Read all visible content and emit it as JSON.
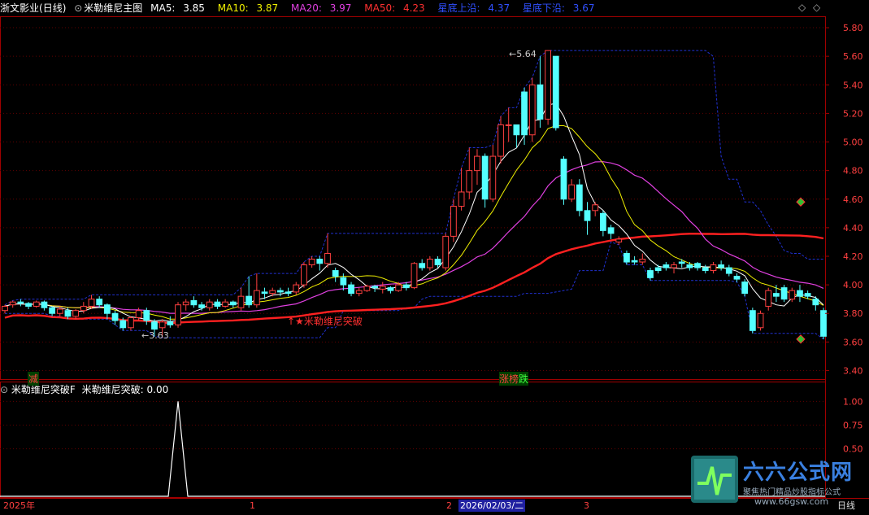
{
  "header": {
    "stock_name": "浙文影业",
    "period": "(日线)",
    "indicator_name": "米勒维尼主图",
    "ma5": {
      "label": "MA5:",
      "value": "3.85",
      "color": "#ffffff"
    },
    "ma10": {
      "label": "MA10:",
      "value": "3.87",
      "color": "#f0f000"
    },
    "ma20": {
      "label": "MA20:",
      "value": "3.97",
      "color": "#e040e0"
    },
    "ma50": {
      "label": "MA50:",
      "value": "4.23",
      "color": "#ff3030"
    },
    "upper": {
      "label": "星底上沿:",
      "value": "4.37",
      "color": "#2040ff"
    },
    "lower": {
      "label": "星底下沿:",
      "value": "3.67",
      "color": "#2040ff"
    }
  },
  "sub_header": {
    "indicator_name": "米勒维尼突破F",
    "value_label": "米勒维尼突破:",
    "value": "0.00"
  },
  "annotations": {
    "high": "5.64",
    "low": "3.63",
    "breakout": "米勒维尼突破",
    "tag_left": "减",
    "tag_mid_a": "涨",
    "tag_mid_b": "榜",
    "tag_mid_c": "跌"
  },
  "time_axis": {
    "labels": [
      "2025年",
      "1",
      "2",
      "3"
    ],
    "cursor_date": "2026/02/03/二",
    "period_label": "日线"
  },
  "price_axis": {
    "ticks": [
      "5.80",
      "5.60",
      "5.40",
      "5.20",
      "5.00",
      "4.80",
      "4.60",
      "4.40",
      "4.20",
      "4.00",
      "3.80",
      "3.60",
      "3.40"
    ]
  },
  "sub_axis": {
    "ticks": [
      "1.00",
      "0.75",
      "0.50"
    ]
  },
  "watermark": {
    "title": "六六公式网",
    "subtitle": "聚焦热门精品炒股指标公式",
    "url": "www.66gsw.com"
  },
  "chart_data": [
    {
      "type": "candlestick",
      "title": "米勒维尼主图",
      "ylim": [
        3.34,
        5.88
      ],
      "up_color": "#ff4040",
      "down_color": "#54ffff",
      "candles": [
        [
          3.82,
          3.85,
          3.8,
          3.86
        ],
        [
          3.86,
          3.88,
          3.84,
          3.89
        ],
        [
          3.88,
          3.87,
          3.85,
          3.9
        ],
        [
          3.87,
          3.85,
          3.83,
          3.88
        ],
        [
          3.85,
          3.88,
          3.84,
          3.89
        ],
        [
          3.88,
          3.84,
          3.82,
          3.89
        ],
        [
          3.84,
          3.8,
          3.78,
          3.85
        ],
        [
          3.8,
          3.83,
          3.78,
          3.85
        ],
        [
          3.82,
          3.78,
          3.76,
          3.84
        ],
        [
          3.78,
          3.82,
          3.76,
          3.83
        ],
        [
          3.82,
          3.85,
          3.8,
          3.88
        ],
        [
          3.85,
          3.9,
          3.83,
          3.93
        ],
        [
          3.9,
          3.86,
          3.84,
          3.92
        ],
        [
          3.86,
          3.8,
          3.76,
          3.87
        ],
        [
          3.8,
          3.75,
          3.72,
          3.82
        ],
        [
          3.75,
          3.7,
          3.68,
          3.77
        ],
        [
          3.7,
          3.77,
          3.68,
          3.78
        ],
        [
          3.77,
          3.82,
          3.75,
          3.84
        ],
        [
          3.82,
          3.75,
          3.72,
          3.84
        ],
        [
          3.74,
          3.69,
          3.64,
          3.76
        ],
        [
          3.7,
          3.74,
          3.63,
          3.76
        ],
        [
          3.74,
          3.72,
          3.7,
          3.78
        ],
        [
          3.72,
          3.86,
          3.7,
          3.88
        ],
        [
          3.86,
          3.88,
          3.82,
          3.9
        ],
        [
          3.89,
          3.86,
          3.84,
          3.92
        ],
        [
          3.86,
          3.84,
          3.82,
          3.88
        ],
        [
          3.84,
          3.88,
          3.82,
          3.9
        ],
        [
          3.88,
          3.85,
          3.83,
          3.9
        ],
        [
          3.85,
          3.88,
          3.84,
          3.9
        ],
        [
          3.88,
          3.86,
          3.84,
          3.89
        ],
        [
          3.84,
          3.92,
          3.82,
          3.98
        ],
        [
          3.92,
          3.86,
          3.84,
          4.06
        ],
        [
          3.86,
          3.96,
          3.84,
          4.08
        ],
        [
          3.95,
          3.94,
          3.9,
          3.98
        ],
        [
          3.94,
          3.96,
          3.92,
          3.98
        ],
        [
          3.96,
          3.95,
          3.92,
          3.98
        ],
        [
          3.95,
          3.94,
          3.92,
          3.98
        ],
        [
          3.95,
          4.0,
          3.93,
          4.02
        ],
        [
          4.0,
          4.14,
          3.98,
          4.16
        ],
        [
          4.14,
          4.18,
          4.12,
          4.2
        ],
        [
          4.18,
          4.15,
          4.1,
          4.2
        ],
        [
          4.15,
          4.22,
          4.12,
          4.36
        ],
        [
          4.1,
          4.06,
          4.02,
          4.12
        ],
        [
          4.05,
          4.0,
          3.96,
          4.08
        ],
        [
          4.0,
          3.94,
          3.92,
          4.02
        ],
        [
          3.94,
          3.96,
          3.92,
          3.98
        ],
        [
          3.96,
          3.99,
          3.95,
          4.0
        ],
        [
          3.99,
          3.98,
          3.95,
          4.0
        ],
        [
          3.97,
          3.99,
          3.94,
          4.02
        ],
        [
          3.98,
          3.96,
          3.94,
          3.99
        ],
        [
          3.96,
          4.0,
          3.95,
          4.02
        ],
        [
          4.0,
          3.98,
          3.96,
          4.02
        ],
        [
          3.98,
          4.15,
          3.97,
          4.16
        ],
        [
          4.15,
          4.12,
          4.1,
          4.18
        ],
        [
          4.12,
          4.18,
          4.1,
          4.2
        ],
        [
          4.18,
          4.14,
          4.12,
          4.2
        ],
        [
          4.12,
          4.34,
          4.1,
          4.36
        ],
        [
          4.34,
          4.55,
          4.3,
          4.6
        ],
        [
          4.55,
          4.65,
          4.52,
          4.82
        ],
        [
          4.65,
          4.8,
          4.6,
          4.96
        ],
        [
          4.8,
          4.9,
          4.7,
          4.95
        ],
        [
          4.9,
          4.6,
          4.54,
          4.92
        ],
        [
          4.6,
          4.9,
          4.58,
          4.98
        ],
        [
          4.9,
          5.12,
          4.85,
          5.18
        ],
        [
          5.12,
          5.12,
          5.0,
          5.24
        ],
        [
          5.12,
          5.05,
          4.96,
          5.1
        ],
        [
          5.35,
          5.05,
          4.98,
          5.38
        ],
        [
          5.05,
          5.4,
          5.0,
          5.45
        ],
        [
          5.4,
          5.16,
          5.1,
          5.6
        ],
        [
          5.16,
          5.64,
          5.12,
          5.64
        ],
        [
          5.6,
          5.1,
          5.08,
          5.6
        ],
        [
          4.88,
          4.6,
          4.56,
          4.9
        ],
        [
          4.6,
          4.7,
          4.58,
          4.74
        ],
        [
          4.7,
          4.52,
          4.48,
          4.74
        ],
        [
          4.52,
          4.45,
          4.35,
          4.58
        ],
        [
          4.52,
          4.56,
          4.48,
          4.58
        ],
        [
          4.5,
          4.38,
          4.34,
          4.52
        ],
        [
          4.4,
          4.36,
          4.32,
          4.42
        ],
        [
          4.3,
          4.32,
          4.28,
          4.34
        ],
        [
          4.22,
          4.16,
          4.14,
          4.24
        ],
        [
          4.17,
          4.16,
          4.14,
          4.2
        ],
        [
          4.16,
          4.18,
          4.14,
          4.22
        ],
        [
          4.1,
          4.05,
          4.03,
          4.12
        ],
        [
          4.12,
          4.1,
          4.08,
          4.14
        ],
        [
          4.14,
          4.12,
          4.1,
          4.16
        ],
        [
          4.12,
          4.14,
          4.08,
          4.16
        ],
        [
          4.16,
          4.15,
          4.12,
          4.18
        ],
        [
          4.14,
          4.12,
          4.1,
          4.16
        ],
        [
          4.15,
          4.12,
          4.1,
          4.16
        ],
        [
          4.12,
          4.1,
          4.08,
          4.14
        ],
        [
          4.1,
          4.14,
          4.08,
          4.16
        ],
        [
          4.14,
          4.12,
          4.1,
          4.17
        ],
        [
          4.12,
          4.08,
          4.06,
          4.14
        ],
        [
          4.06,
          4.04,
          4.02,
          4.08
        ],
        [
          4.02,
          3.94,
          3.92,
          4.04
        ],
        [
          3.82,
          3.68,
          3.66,
          3.84
        ],
        [
          3.7,
          3.8,
          3.68,
          3.82
        ],
        [
          3.85,
          3.96,
          3.82,
          3.98
        ],
        [
          3.94,
          3.92,
          3.88,
          4.0
        ],
        [
          3.98,
          3.9,
          3.88,
          4.0
        ],
        [
          3.9,
          3.96,
          3.88,
          3.98
        ],
        [
          3.96,
          3.92,
          3.88,
          4.0
        ],
        [
          3.94,
          3.92,
          3.9,
          3.96
        ],
        [
          3.9,
          3.86,
          3.82,
          3.92
        ],
        [
          3.82,
          3.64,
          3.62,
          3.84
        ]
      ]
    },
    {
      "type": "line",
      "title": "米勒维尼突破F",
      "ylim": [
        0,
        1.08
      ],
      "series": [
        {
          "name": "米勒维尼突破",
          "impulse_index": 20,
          "impulse_value": 1.0,
          "baseline": 0
        }
      ]
    }
  ]
}
